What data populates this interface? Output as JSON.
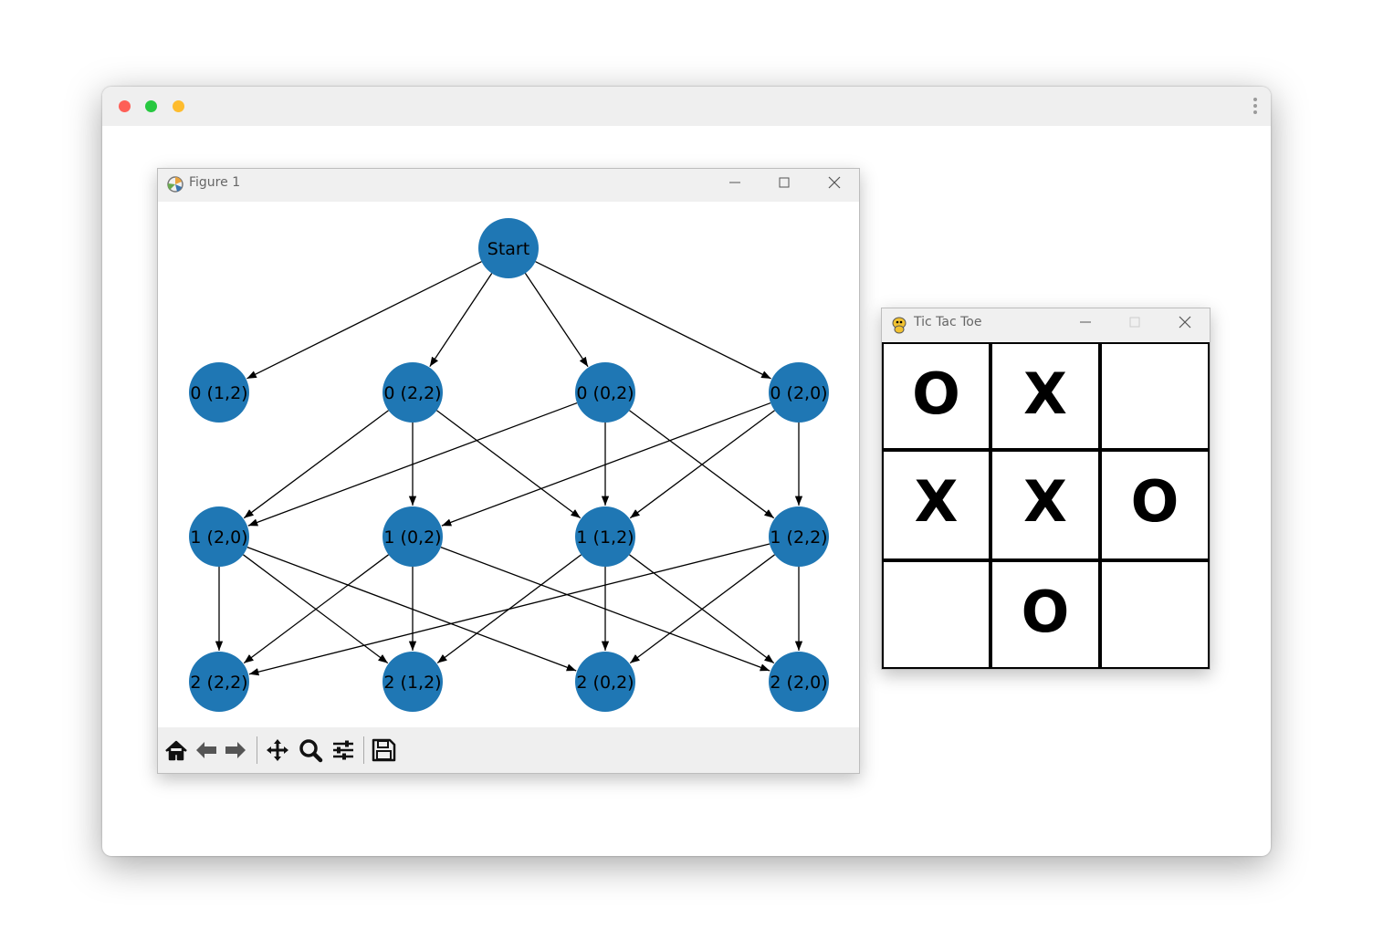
{
  "figure_window": {
    "title": "Figure 1",
    "graph": {
      "nodes": [
        {
          "id": "start",
          "label": "Start"
        },
        {
          "id": "a1",
          "label": "0 (1,2)"
        },
        {
          "id": "a2",
          "label": "0 (2,2)"
        },
        {
          "id": "a3",
          "label": "0 (0,2)"
        },
        {
          "id": "a4",
          "label": "0 (2,0)"
        },
        {
          "id": "b1",
          "label": "1 (2,0)"
        },
        {
          "id": "b2",
          "label": "1 (0,2)"
        },
        {
          "id": "b3",
          "label": "1 (1,2)"
        },
        {
          "id": "b4",
          "label": "1 (2,2)"
        },
        {
          "id": "c1",
          "label": "2 (2,2)"
        },
        {
          "id": "c2",
          "label": "2 (1,2)"
        },
        {
          "id": "c3",
          "label": "2 (0,2)"
        },
        {
          "id": "c4",
          "label": "2 (2,0)"
        }
      ],
      "edges": [
        [
          "start",
          "a1"
        ],
        [
          "start",
          "a2"
        ],
        [
          "start",
          "a3"
        ],
        [
          "start",
          "a4"
        ],
        [
          "a2",
          "b1"
        ],
        [
          "a2",
          "b2"
        ],
        [
          "a2",
          "b3"
        ],
        [
          "a3",
          "b1"
        ],
        [
          "a3",
          "b3"
        ],
        [
          "a3",
          "b4"
        ],
        [
          "a4",
          "b2"
        ],
        [
          "a4",
          "b3"
        ],
        [
          "a4",
          "b4"
        ],
        [
          "b1",
          "c1"
        ],
        [
          "b1",
          "c2"
        ],
        [
          "b1",
          "c3"
        ],
        [
          "b2",
          "c1"
        ],
        [
          "b2",
          "c2"
        ],
        [
          "b2",
          "c4"
        ],
        [
          "b3",
          "c2"
        ],
        [
          "b3",
          "c3"
        ],
        [
          "b3",
          "c4"
        ],
        [
          "b4",
          "c1"
        ],
        [
          "b4",
          "c3"
        ],
        [
          "b4",
          "c4"
        ]
      ],
      "node_color": "#1f77b4"
    },
    "toolbar_icons": [
      "home-icon",
      "back-icon",
      "forward-icon",
      "pan-icon",
      "zoom-icon",
      "configure-subplots-icon",
      "save-icon"
    ]
  },
  "tictactoe_window": {
    "title": "Tic Tac Toe",
    "board": [
      [
        "O",
        "X",
        ""
      ],
      [
        "X",
        "X",
        "O"
      ],
      [
        "",
        "O",
        ""
      ]
    ]
  }
}
